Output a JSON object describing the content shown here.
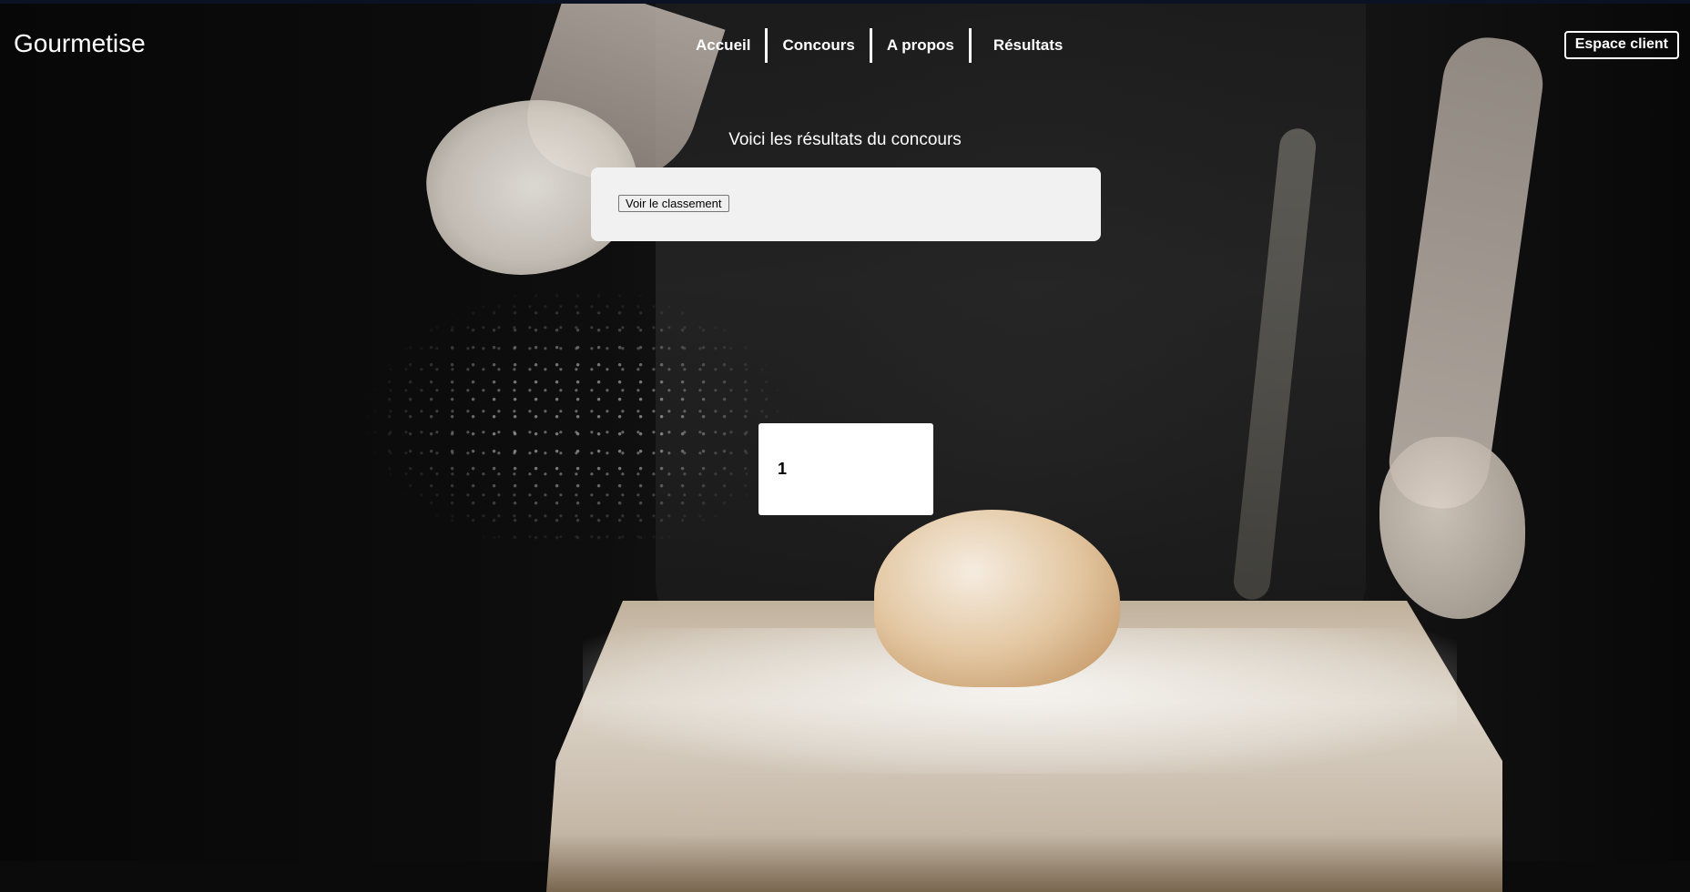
{
  "brand": {
    "name": "Gourmetise"
  },
  "nav": {
    "items": [
      {
        "label": "Accueil"
      },
      {
        "label": "Concours"
      },
      {
        "label": "A propos"
      },
      {
        "label": "Résultats"
      }
    ],
    "account_label": "Espace client"
  },
  "main": {
    "heading": "Voici les résultats du concours",
    "ranking_button_label": "Voir le classement",
    "ranking_card": {
      "position": "1"
    }
  },
  "colors": {
    "text": "#ffffff",
    "panel": "#f1f1f1",
    "card": "#ffffff"
  }
}
